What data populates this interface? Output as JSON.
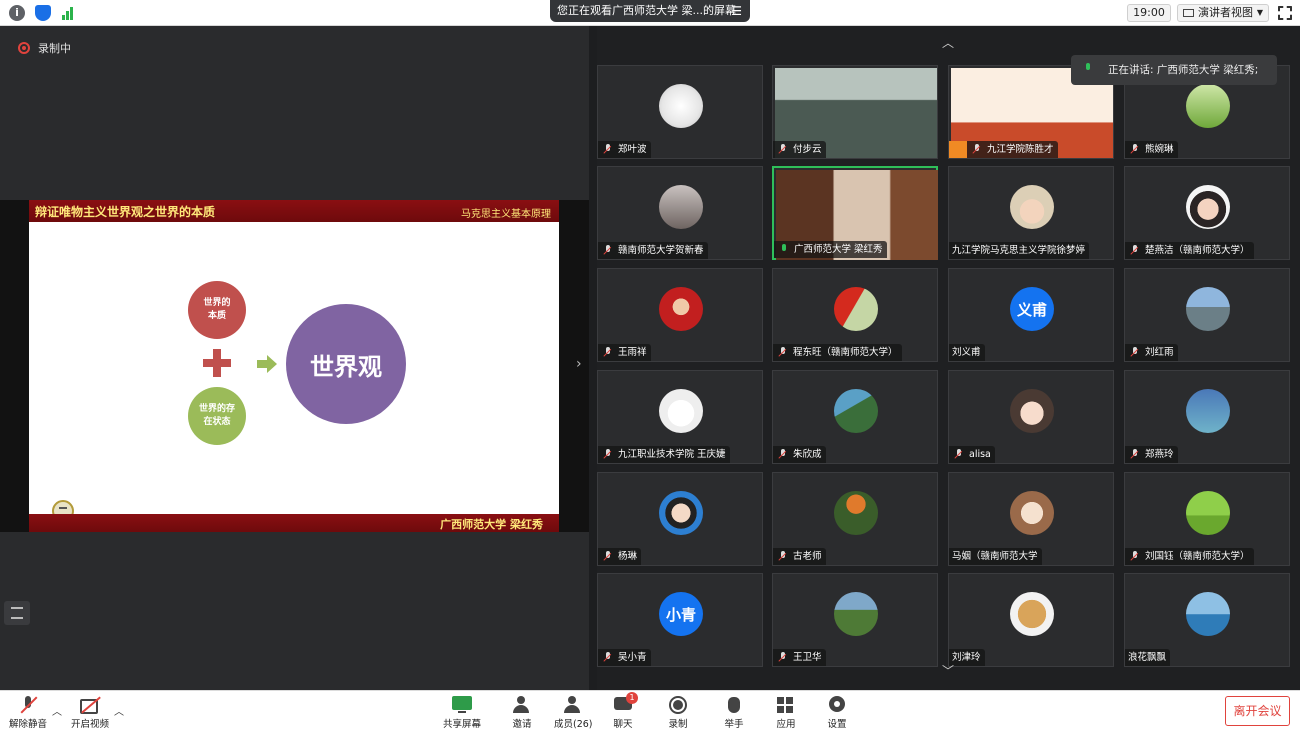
{
  "banner": {
    "text": "您正在观看广西师范大学 梁...的屏幕"
  },
  "topbar": {
    "time": "19:00",
    "view_label": "演讲者视图"
  },
  "recording": {
    "label": "录制中"
  },
  "slide": {
    "title": "辩证唯物主义世界观之世界的本质",
    "course": "马克思主义基本原理",
    "author": "广西师范大学  梁红秀",
    "circle_essence": "世界的本质",
    "circle_state": "世界的存在状态",
    "circle_world": "世界观",
    "colors": {
      "essence": "#c0504d",
      "state": "#9bbb59",
      "world": "#8064a2",
      "banner": "#8a0f12"
    }
  },
  "speaking": {
    "label": "正在讲话: 广西师范大学 梁红秀;"
  },
  "participants": [
    {
      "name": "郑叶波",
      "avatar": "sketch"
    },
    {
      "name": "付步云",
      "avatar": "video-classroom"
    },
    {
      "name": "九江学院陈胜才",
      "avatar": "video-slide"
    },
    {
      "name": "熊婉琳",
      "avatar": "photo-green"
    },
    {
      "name": "赣南师范大学贺新春",
      "avatar": "photo-gray"
    },
    {
      "name": "广西师范大学 梁红秀",
      "avatar": "video-speaker"
    },
    {
      "name": "九江学院马克思主义学院徐梦婷",
      "avatar": "photo-woman"
    },
    {
      "name": "楚燕洁（赣南师范大学）",
      "avatar": "photo-woman2"
    },
    {
      "name": "王雨祥",
      "avatar": "photo-child"
    },
    {
      "name": "程东旺（赣南师范大学）",
      "avatar": "photo-flag"
    },
    {
      "name": "刘义甫",
      "avatar": "text",
      "avatar_text": "义甫"
    },
    {
      "name": "刘红雨",
      "avatar": "photo-sky"
    },
    {
      "name": "九江职业技术学院 王庆婕",
      "avatar": "photo-cartoon"
    },
    {
      "name": "朱欣成",
      "avatar": "photo-coast"
    },
    {
      "name": "alisa",
      "avatar": "photo-anime"
    },
    {
      "name": "郑燕玲",
      "avatar": "photo-blue"
    },
    {
      "name": "杨琳",
      "avatar": "photo-girl"
    },
    {
      "name": "古老师",
      "avatar": "photo-flower"
    },
    {
      "name": "马姻（赣南师范大学",
      "avatar": "photo-doll"
    },
    {
      "name": "刘国钰（赣南师范大学）",
      "avatar": "photo-field"
    },
    {
      "name": "吴小青",
      "avatar": "text",
      "avatar_text": "小青"
    },
    {
      "name": "王卫华",
      "avatar": "photo-trees"
    },
    {
      "name": "刘津玲",
      "avatar": "photo-bear"
    },
    {
      "name": "浪花飘飘",
      "avatar": "photo-sea"
    }
  ],
  "toolbar": {
    "mute": "解除静音",
    "video": "开启视频",
    "share": "共享屏幕",
    "invite": "邀请",
    "participants": "成员(26)",
    "chat": "聊天",
    "chat_badge": "1",
    "record": "录制",
    "raise_hand": "举手",
    "apps": "应用",
    "settings": "设置",
    "leave": "离开会议"
  }
}
